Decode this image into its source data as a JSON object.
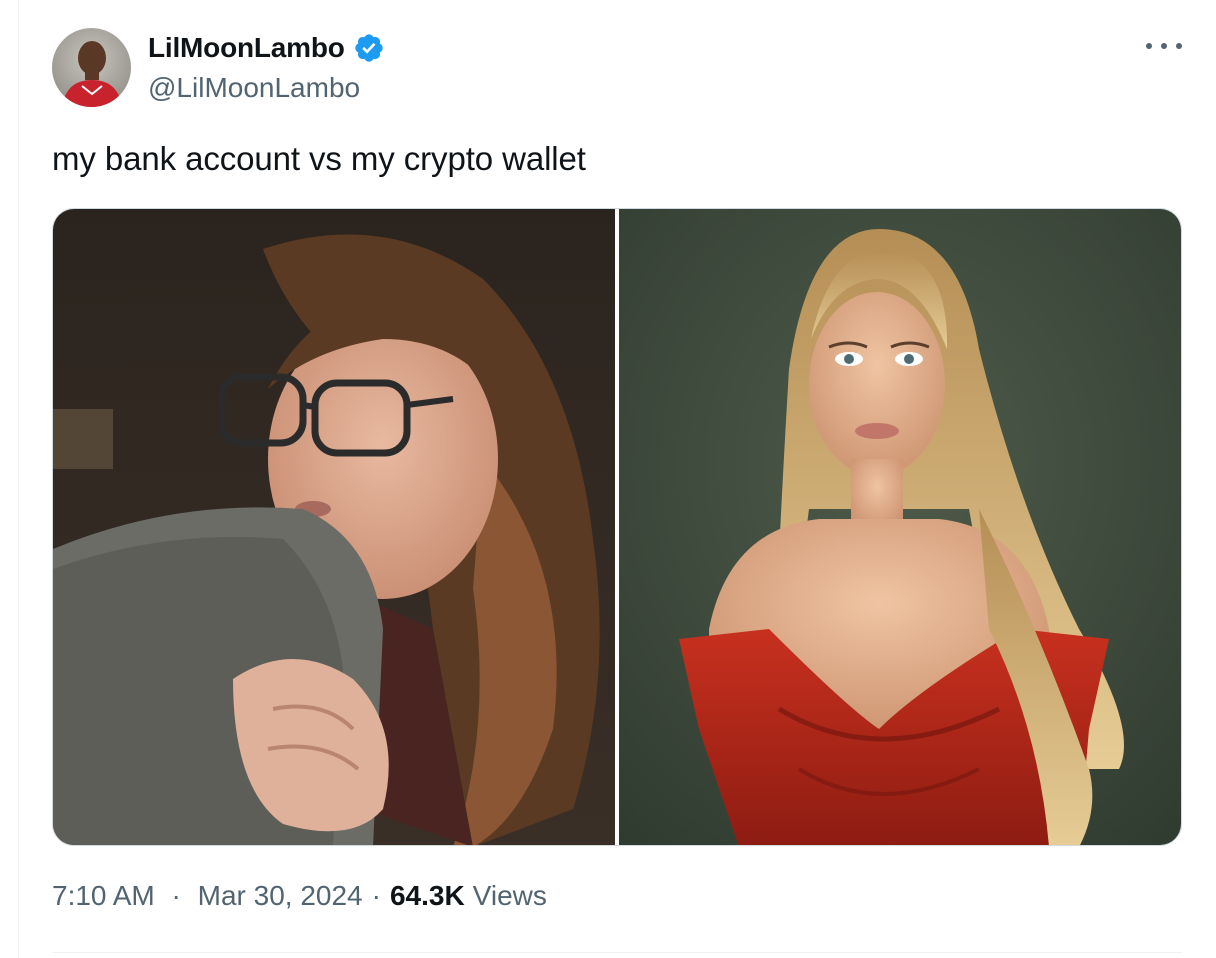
{
  "author": {
    "display_name": "LilMoonLambo",
    "handle": "@LilMoonLambo",
    "verified": true,
    "avatar_icon": "player-avatar-photo",
    "verified_icon": "verified-badge-icon"
  },
  "tweet": {
    "text": "my bank account vs my crypto wallet"
  },
  "media": {
    "images": [
      {
        "name": "photo-left"
      },
      {
        "name": "photo-right"
      }
    ]
  },
  "meta": {
    "time": "7:10 AM",
    "separator": "·",
    "date": "Mar 30, 2024",
    "views_count": "64.3K",
    "views_label": "Views"
  },
  "colors": {
    "primary_text": "#0f1419",
    "secondary_text": "#536471",
    "verified_blue": "#1d9bf0",
    "border": "#cfd9de"
  }
}
